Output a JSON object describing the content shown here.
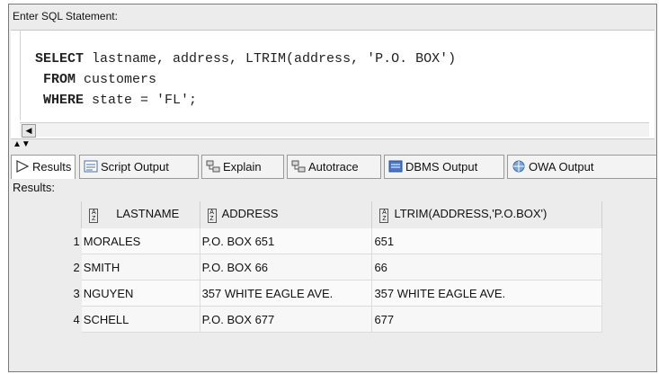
{
  "sql_panel": {
    "label": "Enter SQL Statement:",
    "lines": [
      {
        "kw": "SELECT",
        "rest": " lastname, address, LTRIM(address, 'P.O. BOX')"
      },
      {
        "kw": " FROM",
        "rest": " customers"
      },
      {
        "kw": " WHERE",
        "rest": " state = 'FL';"
      }
    ]
  },
  "splitter_glyph": "▲▼",
  "tabs": [
    {
      "label": "Results",
      "icon": "play-arrow-icon"
    },
    {
      "label": "Script Output",
      "icon": "script-output-icon"
    },
    {
      "label": "Explain",
      "icon": "explain-icon"
    },
    {
      "label": "Autotrace",
      "icon": "autotrace-icon"
    },
    {
      "label": "DBMS Output",
      "icon": "dbms-output-icon"
    },
    {
      "label": "OWA Output",
      "icon": "owa-output-icon"
    }
  ],
  "results": {
    "label": "Results:",
    "columns": [
      "LASTNAME",
      "ADDRESS",
      "LTRIM(ADDRESS,'P.O.BOX')"
    ],
    "rows": [
      {
        "num": "1",
        "cells": [
          "MORALES",
          "P.O. BOX 651",
          "651"
        ]
      },
      {
        "num": "2",
        "cells": [
          "SMITH",
          "P.O. BOX 66",
          "66"
        ]
      },
      {
        "num": "3",
        "cells": [
          "NGUYEN",
          "357 WHITE EAGLE AVE.",
          "357 WHITE EAGLE AVE."
        ]
      },
      {
        "num": "4",
        "cells": [
          "SCHELL",
          "P.O. BOX 677",
          "677"
        ]
      }
    ]
  },
  "colors": {
    "frame": "#7a7a7a",
    "panel_bg": "#ececec",
    "editor_bg": "#ffffff"
  }
}
